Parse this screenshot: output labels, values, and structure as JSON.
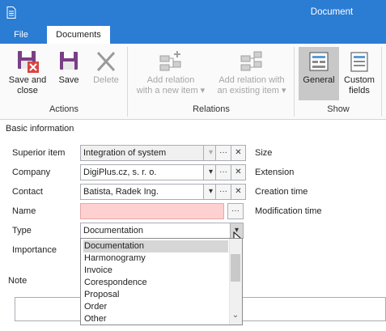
{
  "window": {
    "title": "Document"
  },
  "tabs": {
    "file": "File",
    "documents": "Documents"
  },
  "ribbon": {
    "save_and_close": [
      "Save and",
      "close"
    ],
    "save": "Save",
    "delete": "Delete",
    "add_relation_new": [
      "Add relation",
      "with a new item ▾"
    ],
    "add_relation_existing": [
      "Add relation with",
      "an existing item ▾"
    ],
    "general": "General",
    "custom_fields": [
      "Custom",
      "fields"
    ],
    "groups": {
      "actions": "Actions",
      "relations": "Relations",
      "show": "Show"
    }
  },
  "form": {
    "section_title": "Basic information",
    "labels": {
      "superior_item": "Superior item",
      "company": "Company",
      "contact": "Contact",
      "name": "Name",
      "type": "Type",
      "importance": "Importance",
      "note": "Note"
    },
    "values": {
      "superior_item": "Integration of system",
      "company": "DigiPlus.cz, s. r. o.",
      "contact": "Batista, Radek Ing.",
      "name": "",
      "type": "Documentation"
    },
    "right_labels": {
      "size": "Size",
      "extension": "Extension",
      "creation_time": "Creation time",
      "modification_time": "Modification time"
    },
    "type_options": [
      "Documentation",
      "Harmonogramy",
      "Invoice",
      "Corespondence",
      "Proposal",
      "Order",
      "Other"
    ],
    "type_selected": "Documentation",
    "glyphs": {
      "dropdown": "▾",
      "ellipsis": "···",
      "clear": "✕",
      "scroll_down": "⌄"
    }
  },
  "icons": {
    "doc": "document-icon",
    "save_close": "save-close-icon",
    "save": "save-icon",
    "delete": "delete-x-icon",
    "add_new": "add-relation-new-icon",
    "add_existing": "add-relation-existing-icon",
    "general": "general-layout-icon",
    "custom": "custom-fields-icon"
  },
  "colors": {
    "accent": "#2b7cd3",
    "required_field": "#ffd0d0",
    "save_purple": "#7a3f86",
    "delete_red": "#d64541"
  }
}
